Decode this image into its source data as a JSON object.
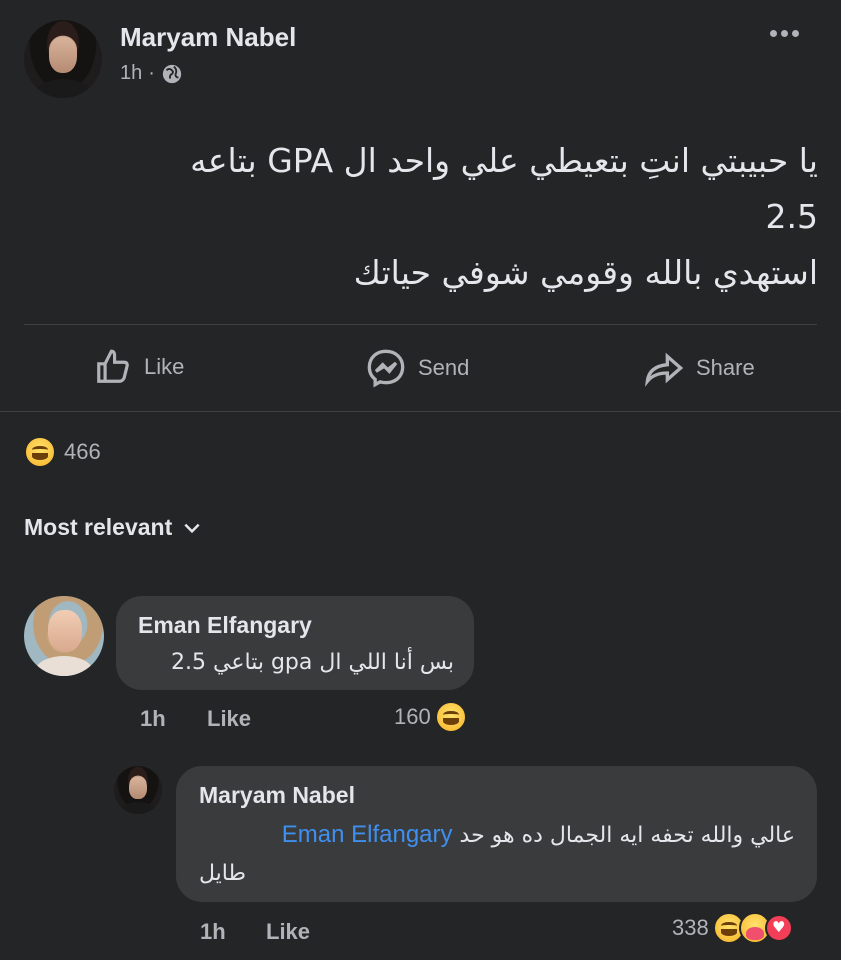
{
  "post": {
    "author": "Maryam Nabel",
    "time": "1h",
    "separator": "·",
    "visibility_icon": "globe-icon",
    "more_icon": "more-dots-icon",
    "text_line1": "يا حبيبتي انتِ بتعيطي علي واحد ال GPA بتاعه",
    "text_line2": "2.5",
    "text_line3": "استهدي بالله وقومي شوفي حياتك"
  },
  "actions": {
    "like": "Like",
    "send": "Send",
    "share": "Share"
  },
  "reactions": {
    "count": "466",
    "type": "haha"
  },
  "filter": {
    "label": "Most relevant"
  },
  "comments": [
    {
      "author": "Eman Elfangary",
      "text": "بس أنا اللي ال gpa بتاعي 2.5",
      "time": "1h",
      "like": "Like",
      "reaction_count": "160"
    }
  ],
  "reply": {
    "author": "Maryam Nabel",
    "mention": "Eman Elfangary",
    "text": "عالي والله تحفه ايه الجمال ده هو حد",
    "text_line2": "طايل",
    "time": "1h",
    "like": "Like",
    "reaction_count": "338"
  },
  "colors": {
    "background": "#242526",
    "bubble": "#3a3b3c",
    "mention": "#3f8ff0",
    "muted": "#b0b3b8"
  }
}
